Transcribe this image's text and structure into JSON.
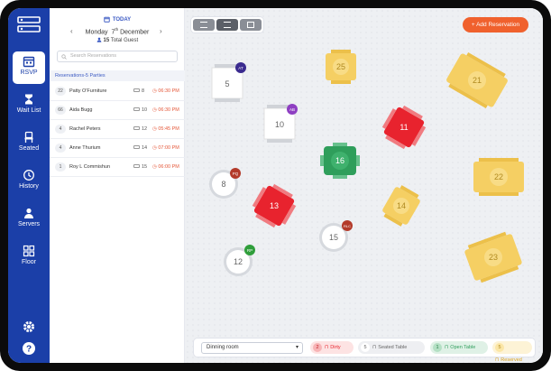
{
  "sidebar": {
    "items": [
      {
        "label": "RSVP",
        "icon": "calendar-icon",
        "active": true
      },
      {
        "label": "Wait List",
        "icon": "hourglass-icon"
      },
      {
        "label": "Seated",
        "icon": "chair-icon"
      },
      {
        "label": "History",
        "icon": "history-icon"
      },
      {
        "label": "Servers",
        "icon": "server-person-icon"
      },
      {
        "label": "Floor",
        "icon": "grid-icon"
      }
    ]
  },
  "panel": {
    "today_label": "TODAY",
    "weekday": "Monday",
    "day": "7",
    "day_suffix": "th",
    "month": "December",
    "guest_count": "15",
    "guest_label": "Total Guest",
    "search_placeholder": "Search Reservations",
    "list_heading": "Reservations-5 Parties",
    "reservations": [
      {
        "party": "22",
        "name": "Patty O'Furniture",
        "table": "8",
        "time": "06:30 PM"
      },
      {
        "party": "66",
        "name": "Aida Bugg",
        "table": "10",
        "time": "06:30 PM"
      },
      {
        "party": "4",
        "name": "Rachel Peters",
        "table": "12",
        "time": "05:45 PM"
      },
      {
        "party": "4",
        "name": "Anne Thurium",
        "table": "14",
        "time": "07:00 PM"
      },
      {
        "party": "1",
        "name": "Roy L Commishun",
        "table": "15",
        "time": "06:00 PM"
      }
    ]
  },
  "floor": {
    "add_button": "+ Add Reservation",
    "tables": [
      {
        "id": "5",
        "status": "seated",
        "badge": "AT"
      },
      {
        "id": "25",
        "status": "reserved"
      },
      {
        "id": "21",
        "status": "reserved"
      },
      {
        "id": "10",
        "status": "seated",
        "badge": "AB"
      },
      {
        "id": "11",
        "status": "dirty"
      },
      {
        "id": "16",
        "status": "open"
      },
      {
        "id": "8",
        "status": "seated",
        "badge": "PQ"
      },
      {
        "id": "22",
        "status": "reserved"
      },
      {
        "id": "13",
        "status": "dirty"
      },
      {
        "id": "14",
        "status": "reserved"
      },
      {
        "id": "15",
        "status": "seated",
        "badge": "RLC"
      },
      {
        "id": "12",
        "status": "seated",
        "badge": "RP"
      },
      {
        "id": "23",
        "status": "reserved"
      }
    ],
    "room_select": "Dinning room",
    "legend": [
      {
        "count": "2",
        "label": "Dirty"
      },
      {
        "count": "5",
        "label": "Seated Table"
      },
      {
        "count": "1",
        "label": "Open Table"
      },
      {
        "count": "5",
        "label": "Reserved"
      }
    ]
  },
  "colors": {
    "sidebar": "#1b3fa8",
    "accent": "#f0612d",
    "dirty": "#e8232e",
    "open": "#2f9e5b",
    "reserved": "#f5cf63",
    "seated": "#ffffff"
  }
}
